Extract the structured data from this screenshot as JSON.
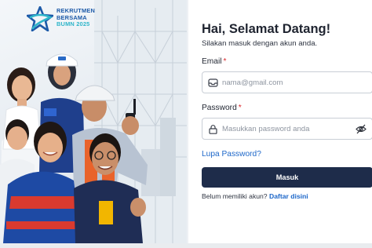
{
  "brand": {
    "line1": "REKRUTMEN",
    "line2": "BERSAMA",
    "line3": "BUMN 2025",
    "logo_icon": "star-logo-icon",
    "colors": {
      "navy": "#1d5aa8",
      "teal": "#2eb5c9"
    }
  },
  "login": {
    "title": "Hai, Selamat Datang!",
    "subtitle": "Silakan masuk dengan akun anda.",
    "email_label": "Email",
    "email_placeholder": "nama@gmail.com",
    "password_label": "Password",
    "password_placeholder": "Masukkan password anda",
    "required_mark": "*",
    "forgot_link": "Lupa Password?",
    "submit_label": "Masuk",
    "register_prompt": "Belum memiliki akun?",
    "register_link": "Daftar disini"
  },
  "colors": {
    "button_bg": "#1e2c4a",
    "link": "#1d67c9",
    "required": "#d8262b"
  },
  "icons": {
    "email": "inbox-icon",
    "password": "lock-icon",
    "toggle_visibility": "eye-off-icon"
  }
}
